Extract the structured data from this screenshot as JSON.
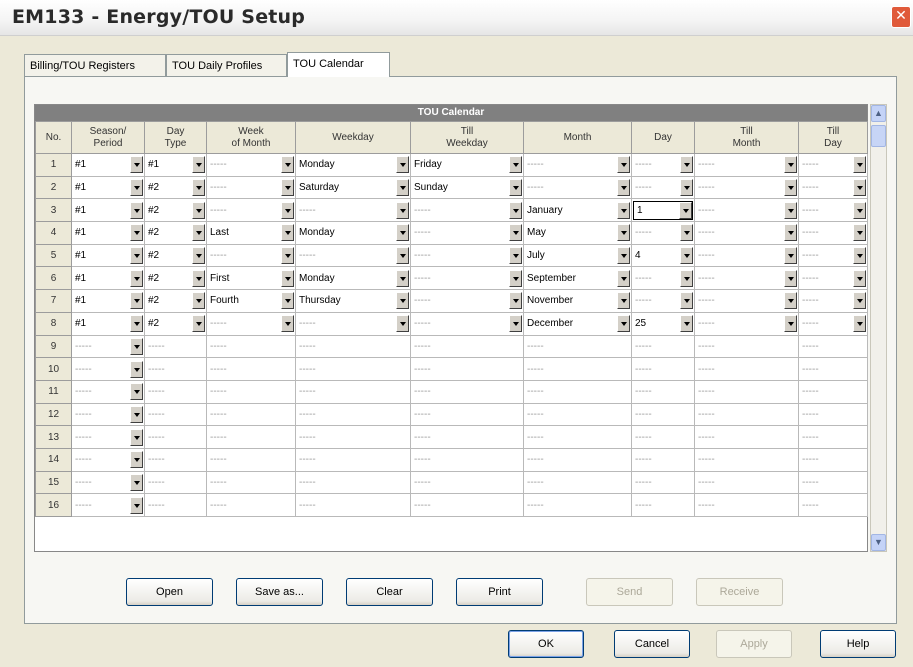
{
  "window": {
    "title": "EM133 - Energy/TOU Setup",
    "close_glyph": "✕"
  },
  "tabs": [
    "Billing/TOU Registers",
    "TOU Daily Profiles",
    "TOU Calendar"
  ],
  "grid": {
    "title": "TOU Calendar",
    "headers": [
      "No.",
      "Season/\nPeriod",
      "Day\nType",
      "Week\nof Month",
      "Weekday",
      "Till\nWeekday",
      "Month",
      "Day",
      "Till\nMonth",
      "Till\nDay"
    ],
    "rows": [
      [
        "1",
        "#1",
        "#1",
        "-----",
        "Monday",
        "Friday",
        "-----",
        "-----",
        "-----",
        "-----"
      ],
      [
        "2",
        "#1",
        "#2",
        "-----",
        "Saturday",
        "Sunday",
        "-----",
        "-----",
        "-----",
        "-----"
      ],
      [
        "3",
        "#1",
        "#2",
        "-----",
        "-----",
        "-----",
        "January",
        "1",
        "-----",
        "-----"
      ],
      [
        "4",
        "#1",
        "#2",
        "Last",
        "Monday",
        "-----",
        "May",
        "-----",
        "-----",
        "-----"
      ],
      [
        "5",
        "#1",
        "#2",
        "-----",
        "-----",
        "-----",
        "July",
        "4",
        "-----",
        "-----"
      ],
      [
        "6",
        "#1",
        "#2",
        "First",
        "Monday",
        "-----",
        "September",
        "-----",
        "-----",
        "-----"
      ],
      [
        "7",
        "#1",
        "#2",
        "Fourth",
        "Thursday",
        "-----",
        "November",
        "-----",
        "-----",
        "-----"
      ],
      [
        "8",
        "#1",
        "#2",
        "-----",
        "-----",
        "-----",
        "December",
        "25",
        "-----",
        "-----"
      ],
      [
        "9",
        "-----",
        "-----",
        "-----",
        "-----",
        "-----",
        "-----",
        "-----",
        "-----",
        "-----"
      ],
      [
        "10",
        "-----",
        "-----",
        "-----",
        "-----",
        "-----",
        "-----",
        "-----",
        "-----",
        "-----"
      ],
      [
        "11",
        "-----",
        "-----",
        "-----",
        "-----",
        "-----",
        "-----",
        "-----",
        "-----",
        "-----"
      ],
      [
        "12",
        "-----",
        "-----",
        "-----",
        "-----",
        "-----",
        "-----",
        "-----",
        "-----",
        "-----"
      ],
      [
        "13",
        "-----",
        "-----",
        "-----",
        "-----",
        "-----",
        "-----",
        "-----",
        "-----",
        "-----"
      ],
      [
        "14",
        "-----",
        "-----",
        "-----",
        "-----",
        "-----",
        "-----",
        "-----",
        "-----",
        "-----"
      ],
      [
        "15",
        "-----",
        "-----",
        "-----",
        "-----",
        "-----",
        "-----",
        "-----",
        "-----",
        "-----"
      ],
      [
        "16",
        "-----",
        "-----",
        "-----",
        "-----",
        "-----",
        "-----",
        "-----",
        "-----",
        "-----"
      ]
    ]
  },
  "scrollbar": {
    "up_glyph": "▲",
    "down_glyph": "▼"
  },
  "actions": [
    {
      "label": "Open",
      "enabled": true
    },
    {
      "label": "Save as...",
      "enabled": true
    },
    {
      "label": "Clear",
      "enabled": true
    },
    {
      "label": "Print",
      "enabled": true
    },
    {
      "label": "Send",
      "enabled": false
    },
    {
      "label": "Receive",
      "enabled": false
    }
  ],
  "dialog_buttons": [
    {
      "label": "OK",
      "enabled": true
    },
    {
      "label": "Cancel",
      "enabled": true
    },
    {
      "label": "Apply",
      "enabled": false
    },
    {
      "label": "Help",
      "enabled": true
    }
  ]
}
